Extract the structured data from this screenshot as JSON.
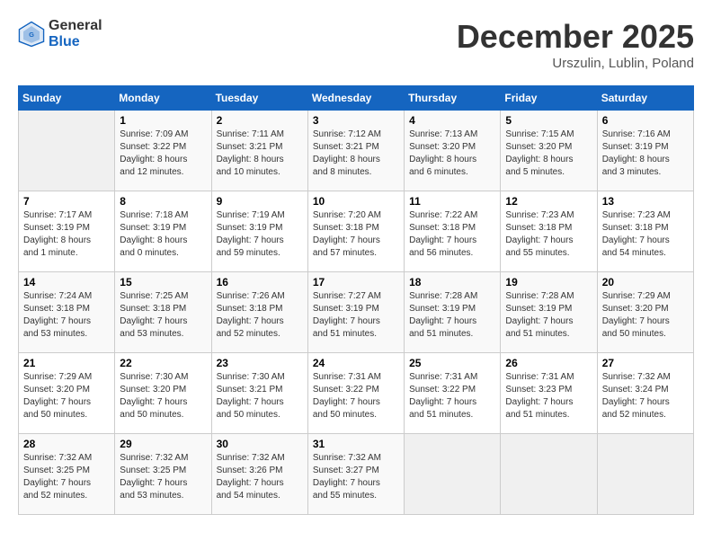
{
  "header": {
    "logo_line1": "General",
    "logo_line2": "Blue",
    "month": "December 2025",
    "location": "Urszulin, Lublin, Poland"
  },
  "weekdays": [
    "Sunday",
    "Monday",
    "Tuesday",
    "Wednesday",
    "Thursday",
    "Friday",
    "Saturday"
  ],
  "rows": [
    [
      {
        "day": "",
        "info": ""
      },
      {
        "day": "1",
        "info": "Sunrise: 7:09 AM\nSunset: 3:22 PM\nDaylight: 8 hours\nand 12 minutes."
      },
      {
        "day": "2",
        "info": "Sunrise: 7:11 AM\nSunset: 3:21 PM\nDaylight: 8 hours\nand 10 minutes."
      },
      {
        "day": "3",
        "info": "Sunrise: 7:12 AM\nSunset: 3:21 PM\nDaylight: 8 hours\nand 8 minutes."
      },
      {
        "day": "4",
        "info": "Sunrise: 7:13 AM\nSunset: 3:20 PM\nDaylight: 8 hours\nand 6 minutes."
      },
      {
        "day": "5",
        "info": "Sunrise: 7:15 AM\nSunset: 3:20 PM\nDaylight: 8 hours\nand 5 minutes."
      },
      {
        "day": "6",
        "info": "Sunrise: 7:16 AM\nSunset: 3:19 PM\nDaylight: 8 hours\nand 3 minutes."
      }
    ],
    [
      {
        "day": "7",
        "info": "Sunrise: 7:17 AM\nSunset: 3:19 PM\nDaylight: 8 hours\nand 1 minute."
      },
      {
        "day": "8",
        "info": "Sunrise: 7:18 AM\nSunset: 3:19 PM\nDaylight: 8 hours\nand 0 minutes."
      },
      {
        "day": "9",
        "info": "Sunrise: 7:19 AM\nSunset: 3:19 PM\nDaylight: 7 hours\nand 59 minutes."
      },
      {
        "day": "10",
        "info": "Sunrise: 7:20 AM\nSunset: 3:18 PM\nDaylight: 7 hours\nand 57 minutes."
      },
      {
        "day": "11",
        "info": "Sunrise: 7:22 AM\nSunset: 3:18 PM\nDaylight: 7 hours\nand 56 minutes."
      },
      {
        "day": "12",
        "info": "Sunrise: 7:23 AM\nSunset: 3:18 PM\nDaylight: 7 hours\nand 55 minutes."
      },
      {
        "day": "13",
        "info": "Sunrise: 7:23 AM\nSunset: 3:18 PM\nDaylight: 7 hours\nand 54 minutes."
      }
    ],
    [
      {
        "day": "14",
        "info": "Sunrise: 7:24 AM\nSunset: 3:18 PM\nDaylight: 7 hours\nand 53 minutes."
      },
      {
        "day": "15",
        "info": "Sunrise: 7:25 AM\nSunset: 3:18 PM\nDaylight: 7 hours\nand 53 minutes."
      },
      {
        "day": "16",
        "info": "Sunrise: 7:26 AM\nSunset: 3:18 PM\nDaylight: 7 hours\nand 52 minutes."
      },
      {
        "day": "17",
        "info": "Sunrise: 7:27 AM\nSunset: 3:19 PM\nDaylight: 7 hours\nand 51 minutes."
      },
      {
        "day": "18",
        "info": "Sunrise: 7:28 AM\nSunset: 3:19 PM\nDaylight: 7 hours\nand 51 minutes."
      },
      {
        "day": "19",
        "info": "Sunrise: 7:28 AM\nSunset: 3:19 PM\nDaylight: 7 hours\nand 51 minutes."
      },
      {
        "day": "20",
        "info": "Sunrise: 7:29 AM\nSunset: 3:20 PM\nDaylight: 7 hours\nand 50 minutes."
      }
    ],
    [
      {
        "day": "21",
        "info": "Sunrise: 7:29 AM\nSunset: 3:20 PM\nDaylight: 7 hours\nand 50 minutes."
      },
      {
        "day": "22",
        "info": "Sunrise: 7:30 AM\nSunset: 3:20 PM\nDaylight: 7 hours\nand 50 minutes."
      },
      {
        "day": "23",
        "info": "Sunrise: 7:30 AM\nSunset: 3:21 PM\nDaylight: 7 hours\nand 50 minutes."
      },
      {
        "day": "24",
        "info": "Sunrise: 7:31 AM\nSunset: 3:22 PM\nDaylight: 7 hours\nand 50 minutes."
      },
      {
        "day": "25",
        "info": "Sunrise: 7:31 AM\nSunset: 3:22 PM\nDaylight: 7 hours\nand 51 minutes."
      },
      {
        "day": "26",
        "info": "Sunrise: 7:31 AM\nSunset: 3:23 PM\nDaylight: 7 hours\nand 51 minutes."
      },
      {
        "day": "27",
        "info": "Sunrise: 7:32 AM\nSunset: 3:24 PM\nDaylight: 7 hours\nand 52 minutes."
      }
    ],
    [
      {
        "day": "28",
        "info": "Sunrise: 7:32 AM\nSunset: 3:25 PM\nDaylight: 7 hours\nand 52 minutes."
      },
      {
        "day": "29",
        "info": "Sunrise: 7:32 AM\nSunset: 3:25 PM\nDaylight: 7 hours\nand 53 minutes."
      },
      {
        "day": "30",
        "info": "Sunrise: 7:32 AM\nSunset: 3:26 PM\nDaylight: 7 hours\nand 54 minutes."
      },
      {
        "day": "31",
        "info": "Sunrise: 7:32 AM\nSunset: 3:27 PM\nDaylight: 7 hours\nand 55 minutes."
      },
      {
        "day": "",
        "info": ""
      },
      {
        "day": "",
        "info": ""
      },
      {
        "day": "",
        "info": ""
      }
    ]
  ]
}
